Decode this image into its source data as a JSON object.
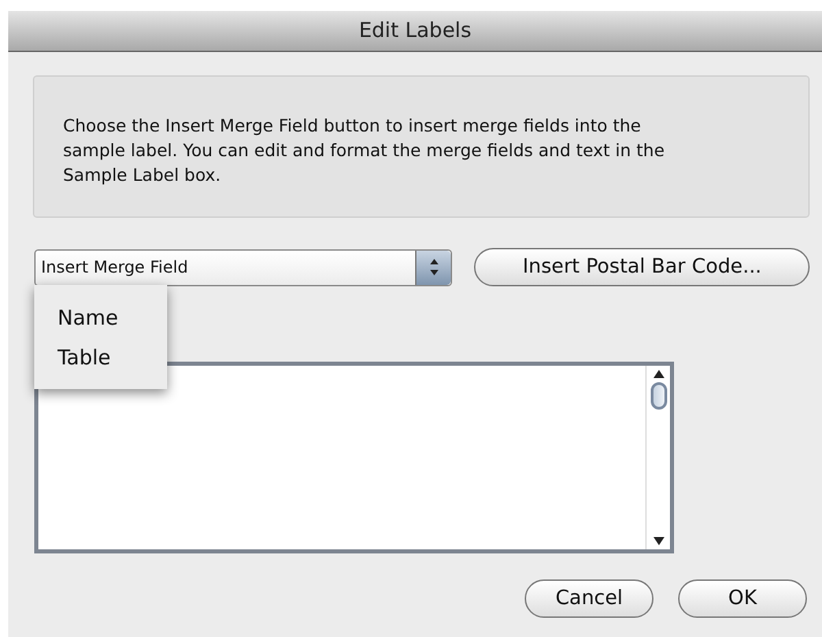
{
  "window": {
    "title": "Edit Labels"
  },
  "instructions": "Choose the Insert Merge Field button to insert merge fields into the sample label.  You can edit and format the merge fields and text in the Sample Label box.",
  "merge_field_popup": {
    "value": "Insert Merge Field",
    "expanded": true,
    "options": [
      {
        "label": "Name"
      },
      {
        "label": "Table"
      }
    ]
  },
  "postal_button": "Insert Postal Bar Code...",
  "buttons": [
    "Cancel",
    "OK"
  ]
}
